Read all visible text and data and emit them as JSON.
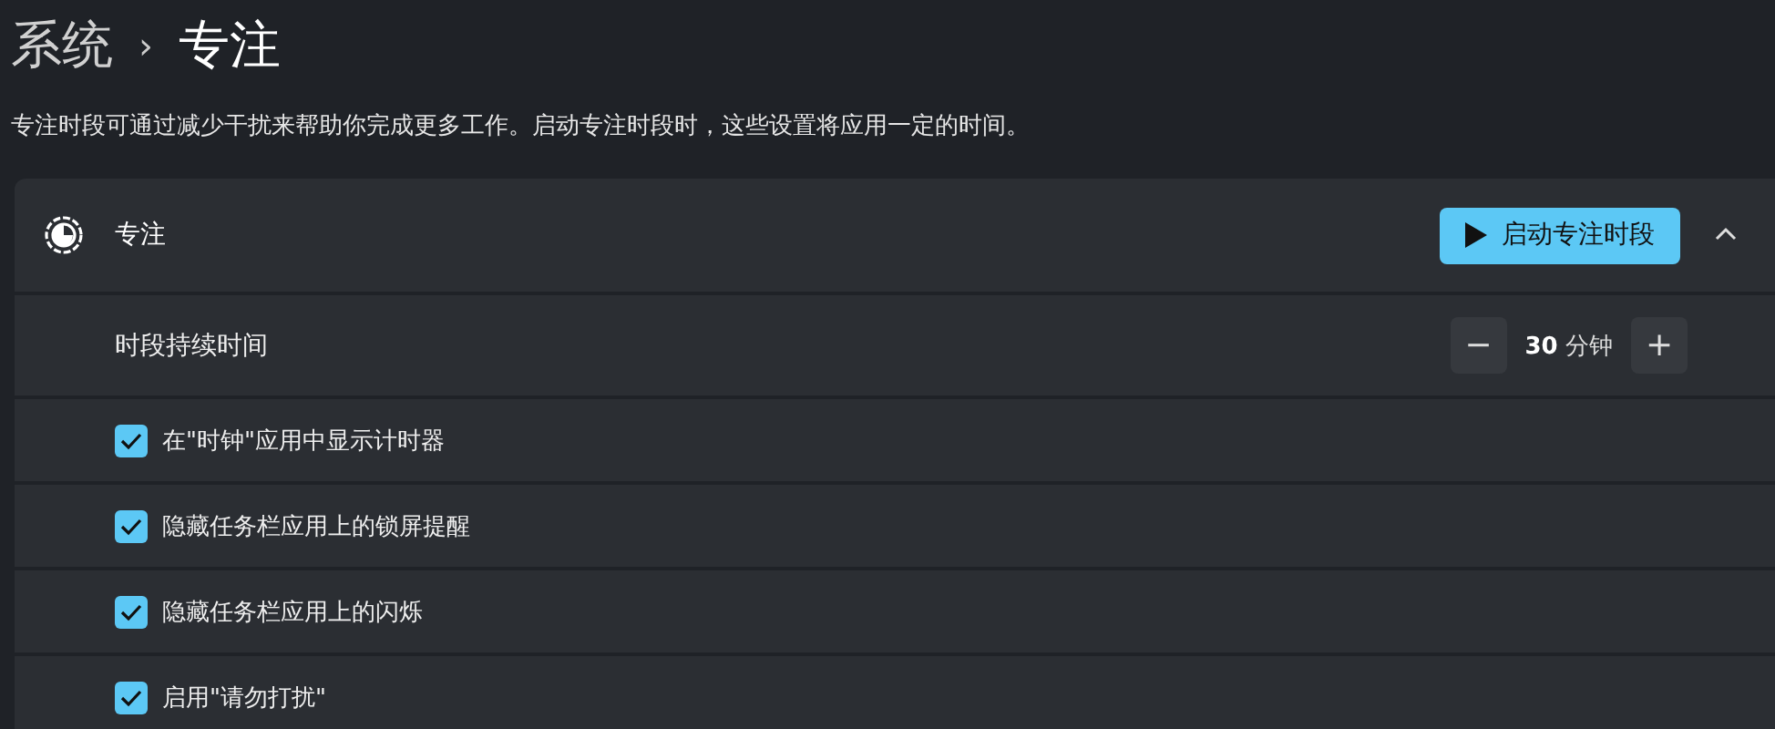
{
  "breadcrumb": {
    "parent": "系统",
    "separator": "›",
    "current": "专注"
  },
  "description": "专注时段可通过减少干扰来帮助你完成更多工作。启动专注时段时，这些设置将应用一定的时间。",
  "focus": {
    "title": "专注",
    "start_button": "启动专注时段",
    "expanded": true
  },
  "duration": {
    "label": "时段持续时间",
    "value": "30",
    "unit": "分钟",
    "decrement": "−",
    "increment": "+"
  },
  "options": [
    {
      "label": "在\"时钟\"应用中显示计时器",
      "checked": true
    },
    {
      "label": "隐藏任务栏应用上的锁屏提醒",
      "checked": true
    },
    {
      "label": "隐藏任务栏应用上的闪烁",
      "checked": true
    },
    {
      "label": "启用\"请勿打扰\"",
      "checked": true
    }
  ]
}
